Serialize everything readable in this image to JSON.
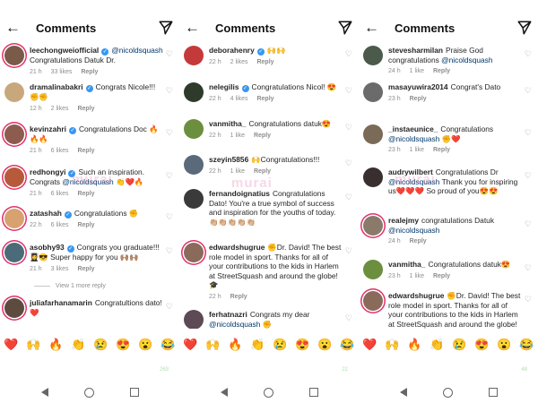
{
  "header": {
    "title": "Comments"
  },
  "watermark": "murai",
  "emojis": [
    "❤️",
    "🙌",
    "🔥",
    "👏",
    "😢",
    "😍",
    "😮",
    "😂"
  ],
  "panels": [
    {
      "comments": [
        {
          "user": "leechongweiofficial",
          "verified": true,
          "text": "",
          "mention": "@nicoldsquash",
          "text2": " Congratulations Datuk Dr.",
          "time": "21 h",
          "likes": "33 likes",
          "reply": "Reply",
          "ring": true,
          "avatar": "#7a5a48"
        },
        {
          "user": "dramalinabakri",
          "verified": true,
          "text": "Congrats Nicole!!! ✊✊",
          "mention": "",
          "text2": "",
          "time": "12 h",
          "likes": "2 likes",
          "reply": "Reply",
          "ring": false,
          "avatar": "#c9a77d"
        },
        {
          "user": "kevinzahri",
          "verified": true,
          "text": "Congratulations Doc 🔥🔥🔥",
          "mention": "",
          "text2": "",
          "time": "21 h",
          "likes": "6 likes",
          "reply": "Reply",
          "ring": true,
          "avatar": "#8e5b4f"
        },
        {
          "user": "redhongyi",
          "verified": true,
          "text": "Such an inspiration. Congrats ",
          "mention": "@nicoldsquash",
          "text2": " 👏❤️🔥",
          "time": "21 h",
          "likes": "6 likes",
          "reply": "Reply",
          "ring": true,
          "avatar": "#b75a3a"
        },
        {
          "user": "zatashah",
          "verified": true,
          "text": "Congratulations ✊",
          "mention": "",
          "text2": "",
          "time": "22 h",
          "likes": "6 likes",
          "reply": "Reply",
          "ring": true,
          "avatar": "#d7a26f"
        },
        {
          "user": "asobhy93",
          "verified": true,
          "text": "Congrats you graduate!!! 👩‍🎓😎 Super happy for you 🙌🏽🙌🏽",
          "mention": "",
          "text2": "",
          "time": "21 h",
          "likes": "3 likes",
          "reply": "Reply",
          "ring": true,
          "avatar": "#4c6b78"
        },
        {
          "user": "juliafarhanamarin",
          "verified": false,
          "text": "Congratultions dato! ❤️",
          "mention": "",
          "text2": "",
          "time": "",
          "likes": "",
          "reply": "",
          "ring": true,
          "avatar": "#5e4b40"
        }
      ],
      "view_more": "View 1 more reply",
      "count": "263"
    },
    {
      "comments": [
        {
          "user": "deborahenry",
          "verified": true,
          "text": "🙌🙌",
          "mention": "",
          "text2": "",
          "time": "22 h",
          "likes": "2 likes",
          "reply": "Reply",
          "ring": false,
          "avatar": "#c43a3a"
        },
        {
          "user": "nelegilis",
          "verified": true,
          "text": "Congratulations Nicol! 😍",
          "mention": "",
          "text2": "",
          "time": "22 h",
          "likes": "4 likes",
          "reply": "Reply",
          "ring": false,
          "avatar": "#2f3b2a"
        },
        {
          "user": "vanmitha_",
          "verified": false,
          "text": "Congratulations datuk😍",
          "mention": "",
          "text2": "",
          "time": "22 h",
          "likes": "1 like",
          "reply": "Reply",
          "ring": false,
          "avatar": "#6c8e3f"
        },
        {
          "user": "szeyin5856",
          "verified": false,
          "text": "🙌Congratulations!!!",
          "mention": "",
          "text2": "",
          "time": "22 h",
          "likes": "1 like",
          "reply": "Reply",
          "ring": false,
          "avatar": "#5a6a7a"
        },
        {
          "user": "fernandoignatius",
          "verified": false,
          "text": "Congratulations Dato! You're a true symbol of success and inspiration for the youths of today. 👏🏼👏🏼👏🏼👏🏼👏🏼",
          "mention": "",
          "text2": "",
          "time": "",
          "likes": "",
          "reply": "",
          "ring": false,
          "avatar": "#3a3a3a"
        },
        {
          "user": "edwardshugrue",
          "verified": false,
          "text": "✊Dr. David!  The best role model in sport.  Thanks for all of your contributions to the kids in Harlem at StreetSquash and around the globe! 🎓",
          "mention": "",
          "text2": "",
          "time": "22 h",
          "likes": "",
          "reply": "Reply",
          "ring": true,
          "avatar": "#8a6a5a"
        },
        {
          "user": "ferhatnazri",
          "verified": false,
          "text": "Congrats my dear ",
          "mention": "@nicoldsquash",
          "text2": " ✊",
          "time": "",
          "likes": "",
          "reply": "",
          "ring": false,
          "avatar": "#5c4a54"
        }
      ],
      "view_more": "",
      "count": "22"
    },
    {
      "comments": [
        {
          "user": "stevesharmilan",
          "verified": false,
          "text": "Praise God congratulations ",
          "mention": "@nicoldsquash",
          "text2": "",
          "time": "24 h",
          "likes": "1 like",
          "reply": "Reply",
          "ring": false,
          "avatar": "#4b5a4b"
        },
        {
          "user": "masayuwira2014",
          "verified": false,
          "text": "Congrat's Dato",
          "mention": "",
          "text2": "",
          "time": "23 h",
          "likes": "",
          "reply": "Reply",
          "ring": false,
          "avatar": "#6b6b6b"
        },
        {
          "user": "_instaeunice_",
          "verified": false,
          "text": "Congratulations ",
          "mention": "@nicoldsquash",
          "text2": " ✊❤️",
          "time": "23 h",
          "likes": "1 like",
          "reply": "Reply",
          "ring": false,
          "avatar": "#7a6a58"
        },
        {
          "user": "audrywilbert",
          "verified": false,
          "text": "Congratulations Dr ",
          "mention": "@nicoldsquash",
          "text2": " Thank you for inspiring us❤️❤️❤️ So proud of you😍😍",
          "time": "",
          "likes": "",
          "reply": "",
          "ring": false,
          "avatar": "#3a2f2f"
        },
        {
          "user": "realejmy",
          "verified": false,
          "text": "congratulations Datuk ",
          "mention": "@nicoldsquash",
          "text2": "",
          "time": "24 h",
          "likes": "",
          "reply": "Reply",
          "ring": true,
          "avatar": "#8a7a6a"
        },
        {
          "user": "vanmitha_",
          "verified": false,
          "text": "Congratulations datuk😍",
          "mention": "",
          "text2": "",
          "time": "23 h",
          "likes": "1 like",
          "reply": "Reply",
          "ring": false,
          "avatar": "#6c8e3f"
        },
        {
          "user": "edwardshugrue",
          "verified": false,
          "text": "✊Dr. David!  The best role model in sport.  Thanks for all of your contributions to the kids in Harlem at StreetSquash and around the globe! 🎓",
          "mention": "",
          "text2": "",
          "time": "",
          "likes": "",
          "reply": "",
          "ring": true,
          "avatar": "#8a6a5a"
        }
      ],
      "view_more": "",
      "count": "48"
    }
  ]
}
